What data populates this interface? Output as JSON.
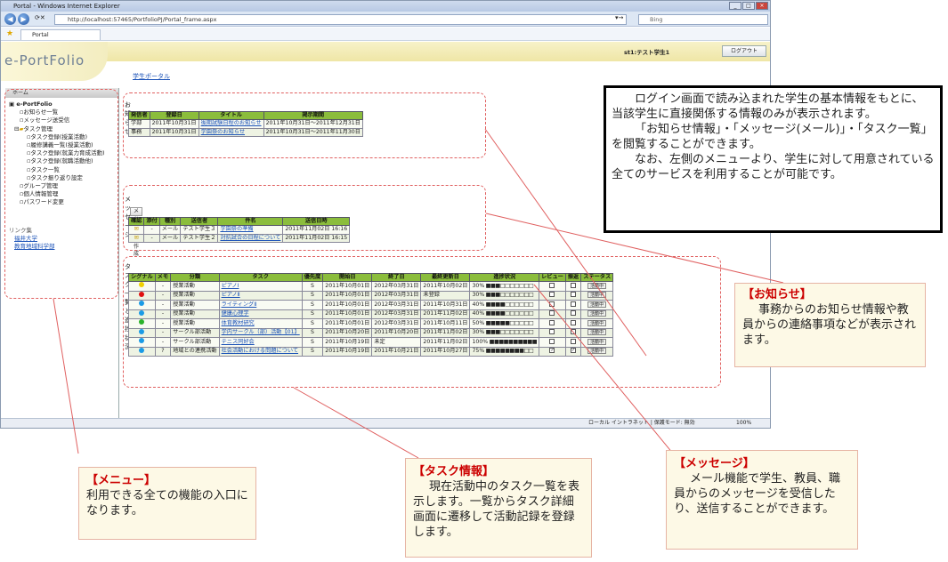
{
  "browser": {
    "window_title": "Portal - Windows Internet Explorer",
    "address": "http://localhost:57465/PortfolioPJ/Portal_frame.aspx",
    "search_placeholder": "Bing",
    "tab_label": "Portal",
    "status_text": "ローカル イントラネット | 保護モード: 無効",
    "zoom": "100%"
  },
  "app": {
    "logo": "e-PortFolio",
    "user_label": "st1:テスト学生1",
    "logout_label": "ログアウト",
    "breadcrumb": "学生ポータル"
  },
  "sidebar": {
    "home_label": "ホーム",
    "root": "e-PortFolio",
    "items": [
      "お知らせ一覧",
      "メッセージ送受信",
      "タスク管理",
      "タスク登録(授業活動)",
      "履修講義一覧(授業活動)",
      "タスク登録(就業力育成活動)",
      "タスク登録(就職活動他)",
      "タスク一覧",
      "タスク振り返り設定",
      "グループ管理",
      "個人情報管理",
      "パスワード変更"
    ],
    "links_title": "リンク集",
    "links": [
      "福井大学",
      "教育地域科学部"
    ]
  },
  "notices": {
    "title": "お知らせ",
    "headers": [
      "発信者",
      "登録日",
      "タイトル",
      "掲示期間"
    ],
    "rows": [
      [
        "学部",
        "2011年10月31日",
        "後期試験日程のお知らせ",
        "2011年10月31日～2011年12月31日"
      ],
      [
        "事務",
        "2011年10月31日",
        "学園祭のお知らせ",
        "2011年10月31日～2011年11月30日"
      ]
    ]
  },
  "messages": {
    "title": "メッセージ",
    "compose_label": "メッセージ作成",
    "headers": [
      "確認",
      "添付",
      "種別",
      "送信者",
      "件名",
      "送信日時"
    ],
    "rows": [
      [
        "",
        "-",
        "メール",
        "テスト学生３",
        "学園祭の準備",
        "2011年11月02日 16:16"
      ],
      [
        "",
        "-",
        "メール",
        "テスト学生２",
        "対抗試合の日程について",
        "2011年11月02日 16:15"
      ]
    ]
  },
  "tasks": {
    "title": "タスク一覧と進捗状況",
    "headers": [
      "シグナル",
      "メモ",
      "分類",
      "タスク",
      "優先度",
      "開始日",
      "終了日",
      "最終更新日",
      "進捗状況",
      "レビュー",
      "振返",
      "ステータス"
    ],
    "rows": [
      {
        "signal": "#f0d000",
        "memo": "-",
        "category": "授業活動",
        "task": "ピアノⅠ",
        "priority": "S",
        "start": "2011年10月01日",
        "end": "2012年03月31日",
        "updated": "2011年10月02日",
        "progress": "30%",
        "filled": 3,
        "review": "",
        "reflect": "",
        "status": "活動中"
      },
      {
        "signal": "#e01010",
        "memo": "-",
        "category": "授業活動",
        "task": "ピアノⅡ",
        "priority": "S",
        "start": "2011年10月01日",
        "end": "2012年03月31日",
        "updated": "未登録",
        "progress": "30%",
        "filled": 3,
        "review": "",
        "reflect": "",
        "status": "活動中"
      },
      {
        "signal": "#1a9be6",
        "memo": "-",
        "category": "授業活動",
        "task": "ライティングⅡ",
        "priority": "S",
        "start": "2011年10月01日",
        "end": "2012年03月31日",
        "updated": "2011年10月31日",
        "progress": "40%",
        "filled": 4,
        "review": "",
        "reflect": "",
        "status": "活動中"
      },
      {
        "signal": "#1a9be6",
        "memo": "-",
        "category": "授業活動",
        "task": "健康心理学",
        "priority": "S",
        "start": "2011年10月01日",
        "end": "2012年03月31日",
        "updated": "2011年11月02日",
        "progress": "40%",
        "filled": 4,
        "review": "",
        "reflect": "",
        "status": "活動中"
      },
      {
        "signal": "#2bb32b",
        "memo": "-",
        "category": "授業活動",
        "task": "体育教材研究",
        "priority": "S",
        "start": "2011年10月01日",
        "end": "2012年03月31日",
        "updated": "2011年10月11日",
        "progress": "50%",
        "filled": 5,
        "review": "",
        "reflect": "",
        "status": "活動中"
      },
      {
        "signal": "#1a9be6",
        "memo": "-",
        "category": "サークル部活動",
        "task": "学内サークル（部）活動【01】",
        "priority": "S",
        "start": "2011年10月20日",
        "end": "2011年10月20日",
        "updated": "2011年11月02日",
        "progress": "30%",
        "filled": 3,
        "review": "",
        "reflect": "",
        "status": "活動中"
      },
      {
        "signal": "#1a9be6",
        "memo": "-",
        "category": "サークル部活動",
        "task": "テニス同好会",
        "priority": "S",
        "start": "2011年10月19日",
        "end": "未定",
        "updated": "2011年11月02日",
        "progress": "100%",
        "filled": 10,
        "review": "",
        "reflect": "",
        "status": "活動中"
      },
      {
        "signal": "#1a9be6",
        "memo": "?",
        "category": "地域との連携活動",
        "task": "社会活動における問題について",
        "priority": "S",
        "start": "2011年10月19日",
        "end": "2011年10月21日",
        "updated": "2011年10月27日",
        "progress": "75%",
        "filled": 8,
        "review": "☑",
        "reflect": "☑",
        "status": "活動中"
      }
    ]
  },
  "annotations": {
    "info": [
      "ログイン画面で読み込まれた学生の基本情報をもとに、当該学生に直接関係する情報のみが表示されます。",
      "「お知らせ情報」・「メッセージ(メール)」・「タスク一覧」を閲覧することができます。",
      "なお、左側のメニューより、学生に対して用意されている全てのサービスを利用することが可能です。"
    ],
    "notice": {
      "title": "【お知らせ】",
      "body": "事務からのお知らせ情報や教員からの連絡事項などが表示されます。"
    },
    "menu": {
      "title": "【メニュー】",
      "body": "利用できる全ての機能の入口になります。"
    },
    "task": {
      "title": "【タスク情報】",
      "body": "現在活動中のタスク一覧を表示します。一覧からタスク詳細画面に遷移して活動記録を登録します。"
    },
    "message": {
      "title": "【メッセージ】",
      "body": "メール機能で学生、教員、職員からのメッセージを受信したり、送信することができます。"
    }
  },
  "colors": {
    "header_green": "#8bbd3c",
    "note_red": "#cc0000"
  }
}
